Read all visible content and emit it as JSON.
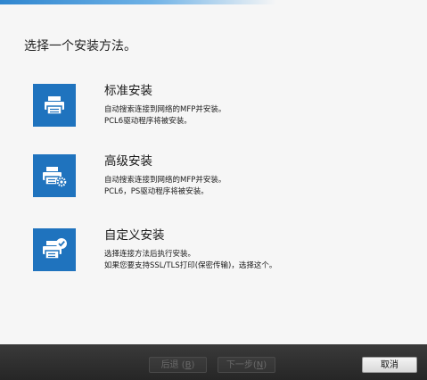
{
  "page_title": "选择一个安装方法。",
  "options": [
    {
      "title": "标准安装",
      "desc1": "自动搜索连接到网络的MFP并安装。",
      "desc2": "PCL6驱动程序将被安装。",
      "icon": "printer-icon"
    },
    {
      "title": "高级安装",
      "desc1": "自动搜索连接到网络的MFP并安装。",
      "desc2": "PCL6，PS驱动程序将被安装。",
      "icon": "printer-gear-icon"
    },
    {
      "title": "自定义安装",
      "desc1": "选择连接方法后执行安装。",
      "desc2": "如果您要支持SSL/TLS打印(保密传输)，选择这个。",
      "icon": "printer-check-icon"
    }
  ],
  "footer": {
    "back_label": "后退 (",
    "back_key": "B",
    "back_end": ")",
    "next_label": "下一步(",
    "next_key": "N",
    "next_end": ")",
    "cancel_label": "取消"
  },
  "colors": {
    "accent": "#1f73be",
    "footer": "#2e2e2e"
  }
}
